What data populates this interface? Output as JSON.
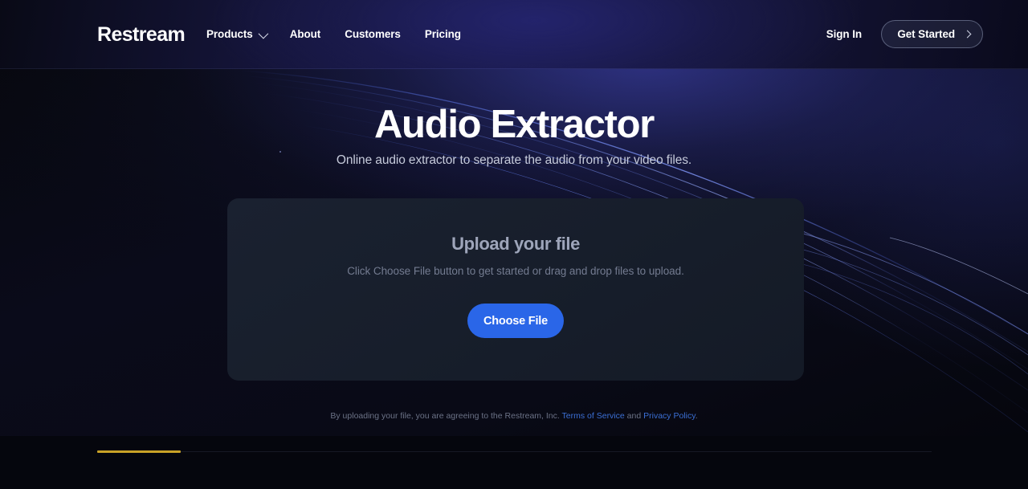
{
  "header": {
    "brand": "Restream",
    "nav": [
      {
        "label": "Products",
        "icon": "chevron-down-icon",
        "has_dropdown": true
      },
      {
        "label": "About",
        "has_dropdown": false
      },
      {
        "label": "Customers",
        "has_dropdown": false
      },
      {
        "label": "Pricing",
        "has_dropdown": false
      }
    ],
    "sign_in": "Sign In",
    "get_started": "Get Started",
    "get_started_icon": "chevron-right-icon"
  },
  "hero": {
    "title": "Audio Extractor",
    "subtitle": "Online audio extractor to separate the audio from your video files."
  },
  "upload": {
    "title": "Upload your file",
    "description": "Click Choose File button to get started or drag and drop files to upload.",
    "button_label": "Choose File"
  },
  "legal": {
    "prefix": "By uploading your file, you are agreeing to the Restream, Inc.",
    "terms_link": "Terms of Service",
    "conjunction": "and",
    "privacy_link": "Privacy Policy",
    "suffix": "."
  },
  "colors": {
    "page_background": "#05060d",
    "header_navy": "#1c1c52",
    "card_background": "#171e2b",
    "accent_blue": "#2a66e8",
    "link_blue": "#3b6fd4",
    "gold_indicator": "#c9a227",
    "title_white": "#ffffff",
    "muted_text": "#737b90"
  }
}
